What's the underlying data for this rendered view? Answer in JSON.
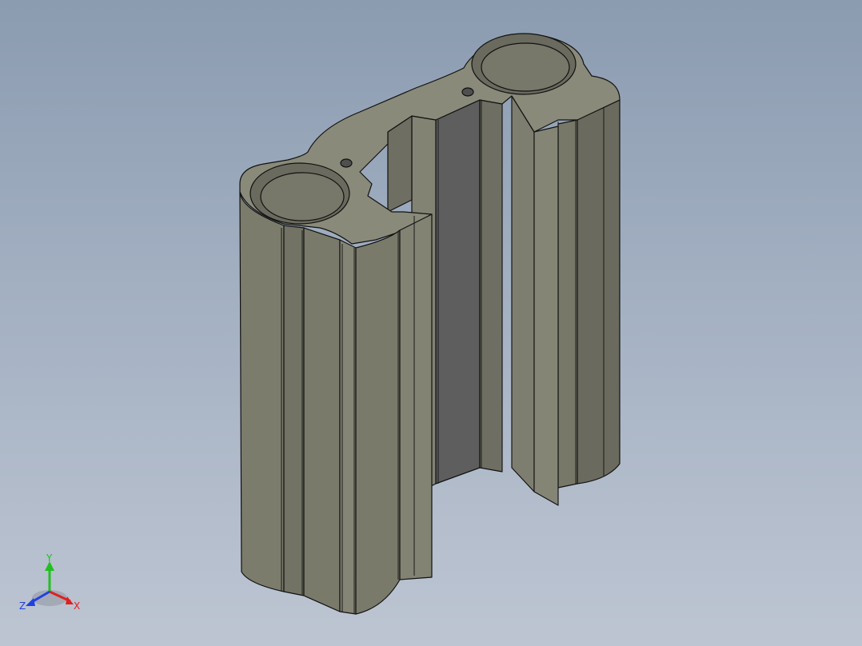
{
  "viewport": {
    "background_top": "#8b9bb0",
    "background_bottom": "#bdc5d2",
    "model": {
      "description_icon": "aluminum-extrusion-profile-model",
      "face_color": "#7b7b6c",
      "top_color": "#8a8a7c",
      "shadow_color": "#5c5c5c",
      "edge_color": "#111111"
    }
  },
  "triad": {
    "x_label": "X",
    "y_label": "Y",
    "z_label": "Z",
    "x_color": "#e02020",
    "y_color": "#20c020",
    "z_color": "#2040e0"
  }
}
